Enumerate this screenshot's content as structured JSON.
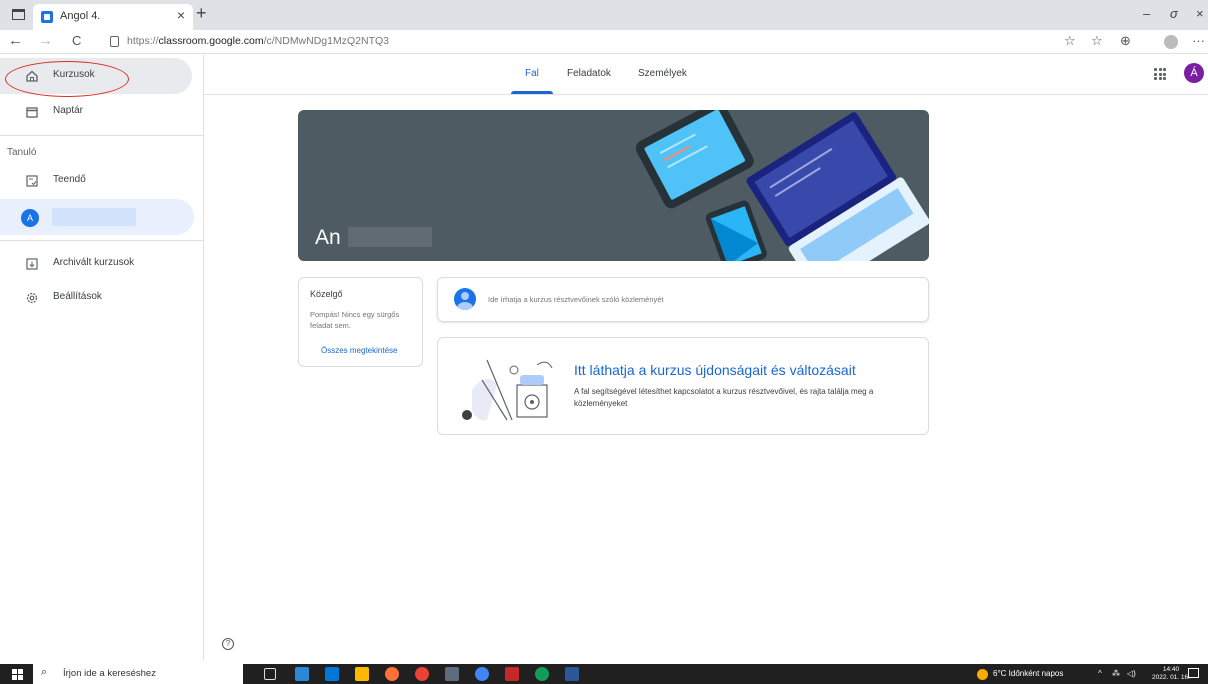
{
  "browser": {
    "tab_title": "Angol 4.",
    "tab_close": "×",
    "new_tab": "+",
    "url_prefix": "https://",
    "url_domain": "classroom.google.com",
    "url_path": "/c/NDMwNDg1MzQ2NTQ3",
    "window_controls": {
      "minimize": "–",
      "restore": "σ",
      "close": "×"
    },
    "nav": {
      "back": "←",
      "forward": "→",
      "reload": "C",
      "more": "···"
    }
  },
  "sidebar": {
    "items": [
      {
        "label": "Kurzusok",
        "icon": "home-icon"
      },
      {
        "label": "Naptár",
        "icon": "calendar-icon"
      }
    ],
    "section_label": "Tanuló",
    "todo_label": "Teendő",
    "course_avatar_letter": "A",
    "archived_label": "Archivált kurzusok",
    "settings_label": "Beállítások",
    "help_glyph": "?"
  },
  "topnav": {
    "tabs": [
      {
        "label": "Fal",
        "active": true
      },
      {
        "label": "Feladatok",
        "active": false
      },
      {
        "label": "Személyek",
        "active": false
      }
    ],
    "user_initial": "Á"
  },
  "banner": {
    "title_visible": "An"
  },
  "upcoming": {
    "title": "Közelgő",
    "text": "Pompás! Nincs egy sürgős feladat sem.",
    "link": "Összes megtekintése"
  },
  "announce": {
    "placeholder": "Ide írhatja a kurzus résztvevőinek szóló közleményét"
  },
  "info_card": {
    "title": "Itt láthatja a kurzus újdonságait és változásait",
    "body": "A fal segítségével létesíthet kapcsolatot a kurzus résztvevőivel, és rajta találja meg a közleményeket"
  },
  "taskbar": {
    "search_placeholder": "Írjon ide a kereséshez",
    "weather": "6°C Időnként napos",
    "time": "14:40",
    "date": "2022. 01. 16."
  },
  "colors": {
    "accent": "#1967d2",
    "banner_bg": "#4f5b62",
    "active_item_bg": "#e8eaed",
    "selected_course_bg": "#e8f0fe",
    "highlight_ellipse": "#d93025",
    "user_avatar": "#7b1fa2"
  }
}
